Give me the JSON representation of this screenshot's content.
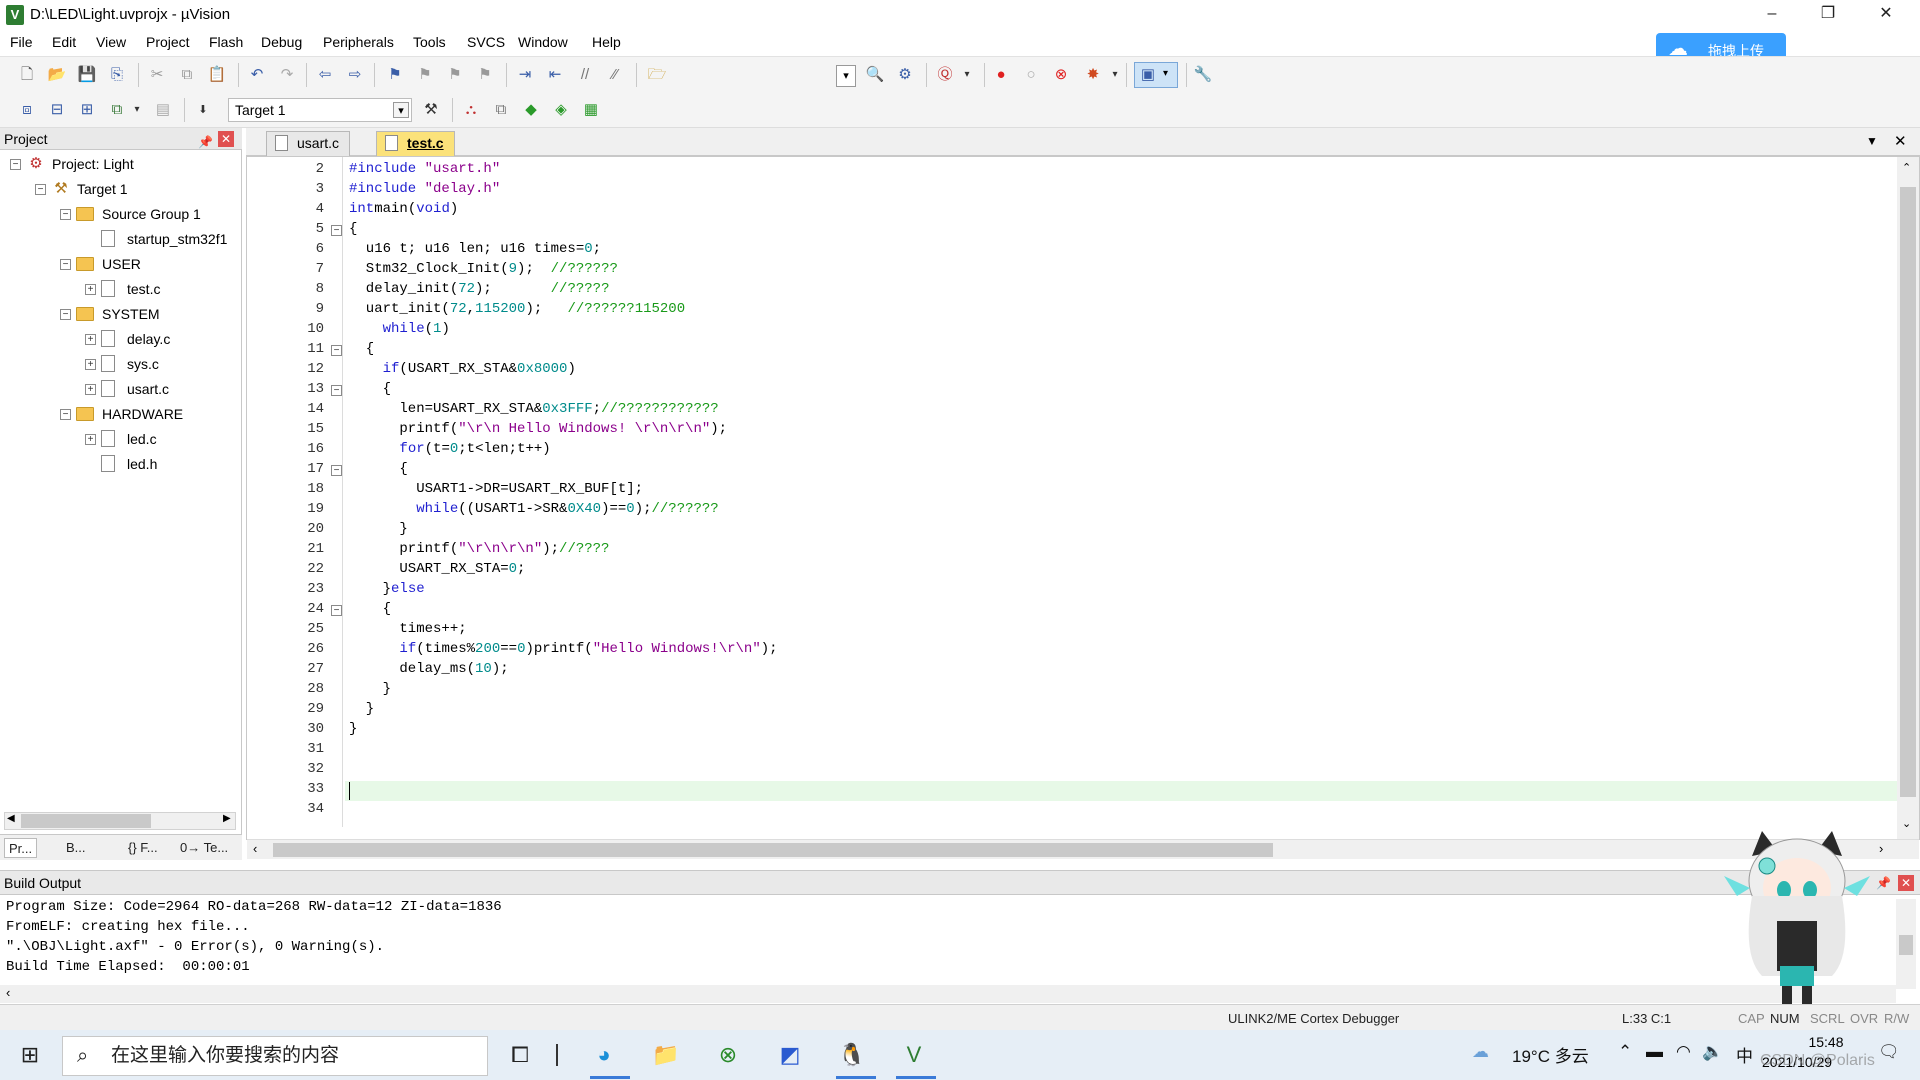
{
  "window": {
    "title": "D:\\LED\\Light.uvprojx - µVision",
    "app_icon": "V",
    "minimize": "–",
    "maximize": "❐",
    "close": "✕"
  },
  "menu": [
    "File",
    "Edit",
    "View",
    "Project",
    "Flash",
    "Debug",
    "Peripherals",
    "Tools",
    "SVCS",
    "Window",
    "Help"
  ],
  "cloud_button": {
    "label": "拖拽上传",
    "icon": "cloud-icon",
    "color": "#3aa0ff"
  },
  "toolbar2": {
    "target": "Target 1"
  },
  "project_panel": {
    "title": "Project",
    "tree": [
      {
        "label": "Project: Light",
        "level": 0,
        "kind": "project",
        "exp": "−"
      },
      {
        "label": "Target 1",
        "level": 1,
        "kind": "target",
        "exp": "−"
      },
      {
        "label": "Source Group 1",
        "level": 2,
        "kind": "folder",
        "exp": "−"
      },
      {
        "label": "startup_stm32f1",
        "level": 3,
        "kind": "file",
        "exp": ""
      },
      {
        "label": "USER",
        "level": 2,
        "kind": "folder",
        "exp": "−"
      },
      {
        "label": "test.c",
        "level": 3,
        "kind": "file",
        "exp": "+"
      },
      {
        "label": "SYSTEM",
        "level": 2,
        "kind": "folder",
        "exp": "−"
      },
      {
        "label": "delay.c",
        "level": 3,
        "kind": "file",
        "exp": "+"
      },
      {
        "label": "sys.c",
        "level": 3,
        "kind": "file",
        "exp": "+"
      },
      {
        "label": "usart.c",
        "level": 3,
        "kind": "file",
        "exp": "+"
      },
      {
        "label": "HARDWARE",
        "level": 2,
        "kind": "folder",
        "exp": "−"
      },
      {
        "label": "led.c",
        "level": 3,
        "kind": "file",
        "exp": "+"
      },
      {
        "label": "led.h",
        "level": 3,
        "kind": "file",
        "exp": ""
      }
    ],
    "tabs": [
      "Pr...",
      "B...",
      "{} F...",
      "0→ Te..."
    ]
  },
  "editor": {
    "tabs": [
      {
        "label": "usart.c",
        "active": false
      },
      {
        "label": "test.c",
        "active": true
      }
    ],
    "lines": [
      {
        "n": "2",
        "fold": "",
        "code": [
          [
            "kw",
            "#include "
          ],
          [
            "str",
            "\"usart.h\""
          ]
        ]
      },
      {
        "n": "3",
        "fold": "",
        "code": [
          [
            "kw",
            "#include "
          ],
          [
            "str",
            "\"delay.h\""
          ]
        ]
      },
      {
        "n": "4",
        "fold": "",
        "code": [
          [
            "kw",
            "int"
          ],
          [
            "",
            "main("
          ],
          [
            "kw",
            "void"
          ],
          [
            "",
            ")"
          ]
        ]
      },
      {
        "n": "5",
        "fold": "−",
        "code": [
          [
            "",
            "{"
          ]
        ]
      },
      {
        "n": "6",
        "fold": "",
        "code": [
          [
            "",
            "  u16 t; u16 len; u16 times="
          ],
          [
            "num",
            "0"
          ],
          [
            "",
            ";"
          ]
        ]
      },
      {
        "n": "7",
        "fold": "",
        "code": [
          [
            "",
            "  Stm32_Clock_Init("
          ],
          [
            "num",
            "9"
          ],
          [
            "",
            ");  "
          ],
          [
            "cmt",
            "//??????"
          ]
        ]
      },
      {
        "n": "8",
        "fold": "",
        "code": [
          [
            "",
            "  delay_init("
          ],
          [
            "num",
            "72"
          ],
          [
            "",
            ");       "
          ],
          [
            "cmt",
            "//?????"
          ]
        ]
      },
      {
        "n": "9",
        "fold": "",
        "code": [
          [
            "",
            "  uart_init("
          ],
          [
            "num",
            "72"
          ],
          [
            "",
            ","
          ],
          [
            "num",
            "115200"
          ],
          [
            "",
            ");   "
          ],
          [
            "cmt",
            "//??????115200"
          ]
        ]
      },
      {
        "n": "10",
        "fold": "",
        "code": [
          [
            "",
            "    "
          ],
          [
            "kw",
            "while"
          ],
          [
            "",
            "("
          ],
          [
            "num",
            "1"
          ],
          [
            "",
            ")"
          ]
        ]
      },
      {
        "n": "11",
        "fold": "−",
        "code": [
          [
            "",
            "  {"
          ]
        ]
      },
      {
        "n": "12",
        "fold": "",
        "code": [
          [
            "",
            "    "
          ],
          [
            "kw",
            "if"
          ],
          [
            "",
            "(USART_RX_STA&"
          ],
          [
            "num",
            "0x8000"
          ],
          [
            "",
            ")"
          ]
        ]
      },
      {
        "n": "13",
        "fold": "−",
        "code": [
          [
            "",
            "    {"
          ]
        ]
      },
      {
        "n": "14",
        "fold": "",
        "code": [
          [
            "",
            "      len=USART_RX_STA&"
          ],
          [
            "num",
            "0x3FFF"
          ],
          [
            "",
            ";"
          ],
          [
            "cmt",
            "//????????????"
          ]
        ]
      },
      {
        "n": "15",
        "fold": "",
        "code": [
          [
            "",
            "      printf("
          ],
          [
            "str",
            "\"\\r\\n Hello Windows! \\r\\n\\r\\n\""
          ],
          [
            "",
            ");"
          ]
        ]
      },
      {
        "n": "16",
        "fold": "",
        "code": [
          [
            "",
            "      "
          ],
          [
            "kw",
            "for"
          ],
          [
            "",
            "(t="
          ],
          [
            "num",
            "0"
          ],
          [
            "",
            ";t<len;t++)"
          ]
        ]
      },
      {
        "n": "17",
        "fold": "−",
        "code": [
          [
            "",
            "      {"
          ]
        ]
      },
      {
        "n": "18",
        "fold": "",
        "code": [
          [
            "",
            "        USART1->DR=USART_RX_BUF[t];"
          ]
        ]
      },
      {
        "n": "19",
        "fold": "",
        "code": [
          [
            "",
            "        "
          ],
          [
            "kw",
            "while"
          ],
          [
            "",
            "((USART1->SR&"
          ],
          [
            "num",
            "0X40"
          ],
          [
            "",
            ")=="
          ],
          [
            "num",
            "0"
          ],
          [
            "",
            ");"
          ],
          [
            "cmt",
            "//??????"
          ]
        ]
      },
      {
        "n": "20",
        "fold": "",
        "code": [
          [
            "",
            "      }"
          ]
        ]
      },
      {
        "n": "21",
        "fold": "",
        "code": [
          [
            "",
            "      printf("
          ],
          [
            "str",
            "\"\\r\\n\\r\\n\""
          ],
          [
            "",
            ");"
          ],
          [
            "cmt",
            "//????"
          ]
        ]
      },
      {
        "n": "22",
        "fold": "",
        "code": [
          [
            "",
            "      USART_RX_STA="
          ],
          [
            "num",
            "0"
          ],
          [
            "",
            ";"
          ]
        ]
      },
      {
        "n": "23",
        "fold": "",
        "code": [
          [
            "",
            "    }"
          ],
          [
            "kw",
            "else"
          ]
        ]
      },
      {
        "n": "24",
        "fold": "−",
        "code": [
          [
            "",
            "    {"
          ]
        ]
      },
      {
        "n": "25",
        "fold": "",
        "code": [
          [
            "",
            "      times++;"
          ]
        ]
      },
      {
        "n": "26",
        "fold": "",
        "code": [
          [
            "",
            "      "
          ],
          [
            "kw",
            "if"
          ],
          [
            "",
            "(times%"
          ],
          [
            "num",
            "200"
          ],
          [
            "",
            "=="
          ],
          [
            "num",
            "0"
          ],
          [
            "",
            ")printf("
          ],
          [
            "str",
            "\"Hello Windows!\\r\\n\""
          ],
          [
            "",
            ");"
          ]
        ]
      },
      {
        "n": "27",
        "fold": "",
        "code": [
          [
            "",
            "      delay_ms("
          ],
          [
            "num",
            "10"
          ],
          [
            "",
            ");"
          ]
        ]
      },
      {
        "n": "28",
        "fold": "",
        "code": [
          [
            "",
            "    }"
          ]
        ]
      },
      {
        "n": "29",
        "fold": "",
        "code": [
          [
            "",
            "  }"
          ]
        ]
      },
      {
        "n": "30",
        "fold": "",
        "code": [
          [
            "",
            "}"
          ]
        ]
      },
      {
        "n": "31",
        "fold": "",
        "code": []
      },
      {
        "n": "32",
        "fold": "",
        "code": []
      },
      {
        "n": "33",
        "fold": "",
        "code": []
      },
      {
        "n": "34",
        "fold": "",
        "code": []
      }
    ]
  },
  "build_output": {
    "title": "Build Output",
    "lines": [
      "Program Size: Code=2964 RO-data=268 RW-data=12 ZI-data=1836",
      "FromELF: creating hex file...",
      "\".\\OBJ\\Light.axf\" - 0 Error(s), 0 Warning(s).",
      "Build Time Elapsed:  00:00:01"
    ]
  },
  "status": {
    "debugger": "ULINK2/ME Cortex Debugger",
    "position": "L:33 C:1",
    "flags": [
      "CAP",
      "NUM",
      "SCRL",
      "OVR",
      "R/W"
    ]
  },
  "taskbar": {
    "search_placeholder": "在这里输入你要搜索的内容",
    "weather": "19°C 多云",
    "ime": "中",
    "time": "15:48",
    "date": "2021/10/29",
    "watermark": "CSDN @Polaris"
  }
}
